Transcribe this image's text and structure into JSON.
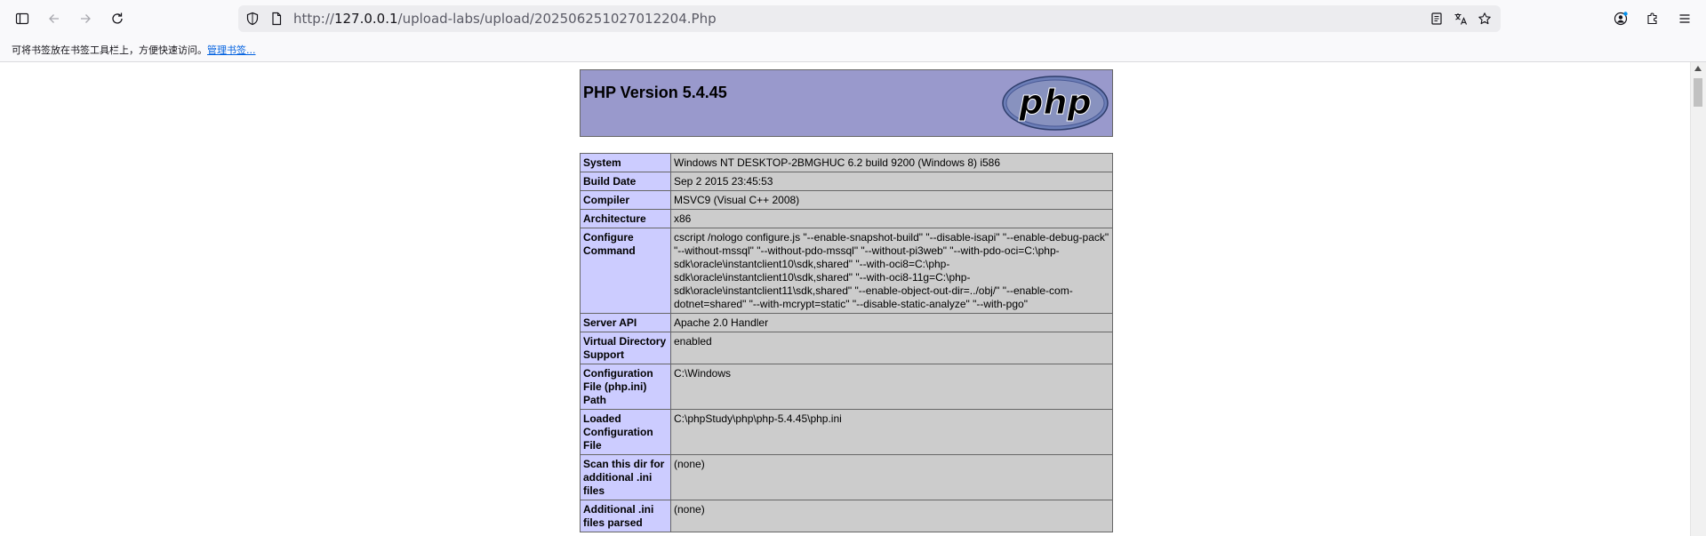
{
  "browser": {
    "url_prefix": "http://",
    "url_host": "127.0.0.1",
    "url_path": "/upload-labs/upload/202506251027012204.Php"
  },
  "bookmarks_bar": {
    "message": "可将书签放在书签工具栏上，方便快速访问。",
    "manage_link": "管理书签..."
  },
  "phpinfo": {
    "title": "PHP Version 5.4.45",
    "logo_text": "php",
    "rows": [
      {
        "key": "System",
        "value": "Windows NT DESKTOP-2BMGHUC 6.2 build 9200 (Windows 8) i586"
      },
      {
        "key": "Build Date",
        "value": "Sep 2 2015 23:45:53"
      },
      {
        "key": "Compiler",
        "value": "MSVC9 (Visual C++ 2008)"
      },
      {
        "key": "Architecture",
        "value": "x86"
      },
      {
        "key": "Configure Command",
        "value": "cscript /nologo configure.js \"--enable-snapshot-build\" \"--disable-isapi\" \"--enable-debug-pack\" \"--without-mssql\" \"--without-pdo-mssql\" \"--without-pi3web\" \"--with-pdo-oci=C:\\php-sdk\\oracle\\instantclient10\\sdk,shared\" \"--with-oci8=C:\\php-sdk\\oracle\\instantclient10\\sdk,shared\" \"--with-oci8-11g=C:\\php-sdk\\oracle\\instantclient11\\sdk,shared\" \"--enable-object-out-dir=../obj/\" \"--enable-com-dotnet=shared\" \"--with-mcrypt=static\" \"--disable-static-analyze\" \"--with-pgo\""
      },
      {
        "key": "Server API",
        "value": "Apache 2.0 Handler"
      },
      {
        "key": "Virtual Directory Support",
        "value": "enabled"
      },
      {
        "key": "Configuration File (php.ini) Path",
        "value": "C:\\Windows"
      },
      {
        "key": "Loaded Configuration File",
        "value": "C:\\phpStudy\\php\\php-5.4.45\\php.ini"
      },
      {
        "key": "Scan this dir for additional .ini files",
        "value": "(none)"
      },
      {
        "key": "Additional .ini files parsed",
        "value": "(none)"
      }
    ]
  }
}
